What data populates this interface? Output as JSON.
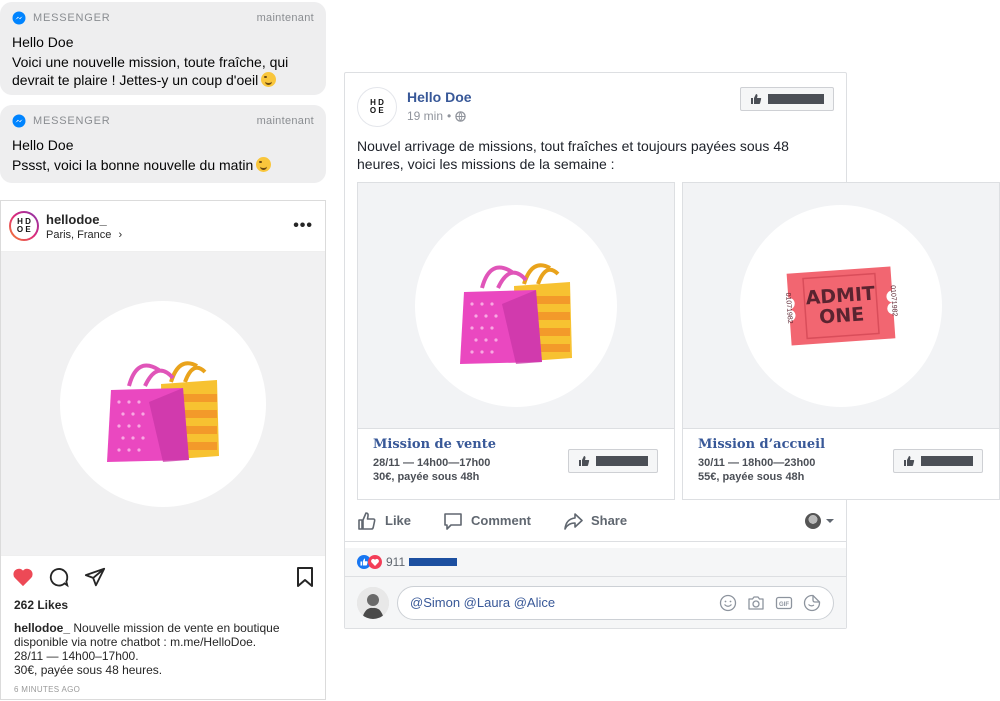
{
  "messenger_notifications": [
    {
      "app": "MESSENGER",
      "time": "maintenant",
      "title": "Hello Doe",
      "body": "Voici une nouvelle mission, toute fraîche, qui devrait te plaire ! Jettes-y un coup d'oeil"
    },
    {
      "app": "MESSENGER",
      "time": "maintenant",
      "title": "Hello Doe",
      "body": "Pssst, voici la bonne nouvelle du matin"
    }
  ],
  "instagram": {
    "logo_letters": [
      "H",
      "D",
      "O",
      "E"
    ],
    "username": "hellodoe_",
    "location": "Paris, France",
    "likes": "262 Likes",
    "caption_user": "hellodoe_",
    "caption_lines": [
      "Nouvelle mission de vente en boutique",
      "disponible via notre chatbot : m.me/HelloDoe.",
      "28/11 — 14h00–17h00.",
      "30€, payée sous 48 heures."
    ],
    "time": "6 MINUTES AGO"
  },
  "facebook": {
    "logo_letters": [
      "H",
      "D",
      "O",
      "E"
    ],
    "page_name": "Hello Doe",
    "time": "19 min",
    "text": "Nouvel arrivage de missions, tout fraîches et toujours payées sous 48 heures, voici les missions de la semaine :",
    "cards": [
      {
        "title": "Mission de vente",
        "line1": "28/11 — 14h00—17h00",
        "line2": "30€, payée sous 48h"
      },
      {
        "title": "Mission d’accueil",
        "line1": "30/11 — 18h00—23h00",
        "line2": "55€, payée sous 48h"
      }
    ],
    "ticket": {
      "line1": "ADMIT",
      "line2": "ONE",
      "serial": "01071982"
    },
    "actions": {
      "like": "Like",
      "comment": "Comment",
      "share": "Share"
    },
    "reaction_count": "911",
    "comment_text": "@Simon @Laura @Alice",
    "comment_icons": [
      "smiley-icon",
      "camera-icon",
      "gif-icon",
      "sticker-icon"
    ],
    "colors": {
      "link": "#385898",
      "messenger": "#0084ff",
      "heart": "#ed4956"
    }
  }
}
